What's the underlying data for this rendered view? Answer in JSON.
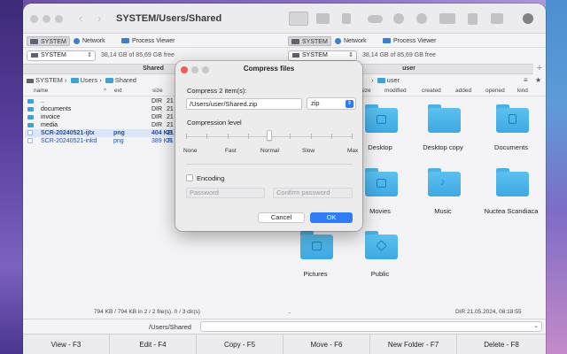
{
  "window": {
    "title": "SYSTEM/Users/Shared"
  },
  "left_panel": {
    "tabs": [
      {
        "label": "SYSTEM",
        "icon": "drive-icon",
        "active": true
      },
      {
        "label": "Network",
        "icon": "globe-icon",
        "active": false
      },
      {
        "label": "Process Viewer",
        "icon": "process-icon",
        "active": false
      }
    ],
    "drive": "SYSTEM",
    "free_space": "38,14 GB of 85,69 GB free",
    "path_header": "Shared",
    "breadcrumb": [
      "SYSTEM",
      "Users",
      "Shared"
    ],
    "columns": [
      "name",
      "ext",
      "size"
    ],
    "rows": [
      {
        "name": "..",
        "ext": "",
        "size": "DIR",
        "date": "21",
        "selected": false,
        "type": "folder"
      },
      {
        "name": "documents",
        "ext": "",
        "size": "DIR",
        "date": "21",
        "selected": false,
        "type": "folder"
      },
      {
        "name": "invoice",
        "ext": "",
        "size": "DIR",
        "date": "21",
        "selected": false,
        "type": "folder"
      },
      {
        "name": "media",
        "ext": "",
        "size": "DIR",
        "date": "21",
        "selected": false,
        "type": "folder"
      },
      {
        "name": "SCR-20240521-ijtx",
        "ext": "png",
        "size": "404 KB",
        "date": "21",
        "selected": true,
        "type": "file"
      },
      {
        "name": "SCR-20240521-inkd",
        "ext": "png",
        "size": "389 KB",
        "date": "21",
        "selected": false,
        "type": "file"
      }
    ],
    "status": "794 KB / 794 KB in 2 / 2 file(s). 0 / 3 dir(s)"
  },
  "right_panel": {
    "tabs": [
      {
        "label": "SYSTEM",
        "icon": "drive-icon",
        "active": true
      },
      {
        "label": "Network",
        "icon": "globe-icon",
        "active": false
      },
      {
        "label": "Process Viewer",
        "icon": "process-icon",
        "active": false
      }
    ],
    "drive": "SYSTEM",
    "free_space": "38,14 GB of 85,69 GB free",
    "path_header": "user",
    "breadcrumb_tail": "user",
    "columns": [
      "size",
      "modified",
      "created",
      "added",
      "opened",
      "kind"
    ],
    "tiles": [
      {
        "label": "Desktop",
        "icon": "desktop-folder-icon"
      },
      {
        "label": "Desktop copy",
        "icon": "folder-icon"
      },
      {
        "label": "Documents",
        "icon": "documents-folder-icon"
      },
      {
        "label": "Movies",
        "icon": "movies-folder-icon"
      },
      {
        "label": "Music",
        "icon": "music-folder-icon"
      },
      {
        "label": "Nuctea Scandiaca",
        "icon": "folder-icon"
      },
      {
        "label": "Pictures",
        "icon": "pictures-folder-icon"
      },
      {
        "label": "Public",
        "icon": "public-folder-icon"
      }
    ],
    "status_left": "..",
    "status_right": "DIR  21.05.2024, 08:18:55"
  },
  "command_line": {
    "path": "/Users/Shared"
  },
  "fkeys": [
    "View - F3",
    "Edit - F4",
    "Copy - F5",
    "Move - F6",
    "New Folder - F7",
    "Delete - F8"
  ],
  "dialog": {
    "title": "Compress files",
    "subtitle": "Compress 2 item(s):",
    "path_value": "/Users/user/Shared.zip",
    "format": "zip",
    "level_label": "Compression level",
    "levels": [
      "None",
      "Fast",
      "Normal",
      "Slow",
      "Max"
    ],
    "selected_level": "Normal",
    "encoding_label": "Encoding",
    "encoding_checked": false,
    "password_placeholder": "Password",
    "confirm_placeholder": "Confirm password",
    "cancel_label": "Cancel",
    "ok_label": "OK"
  },
  "colors": {
    "accent": "#2f7cf6",
    "folder": "#4ab0e6",
    "selection": "#dce6f7"
  }
}
